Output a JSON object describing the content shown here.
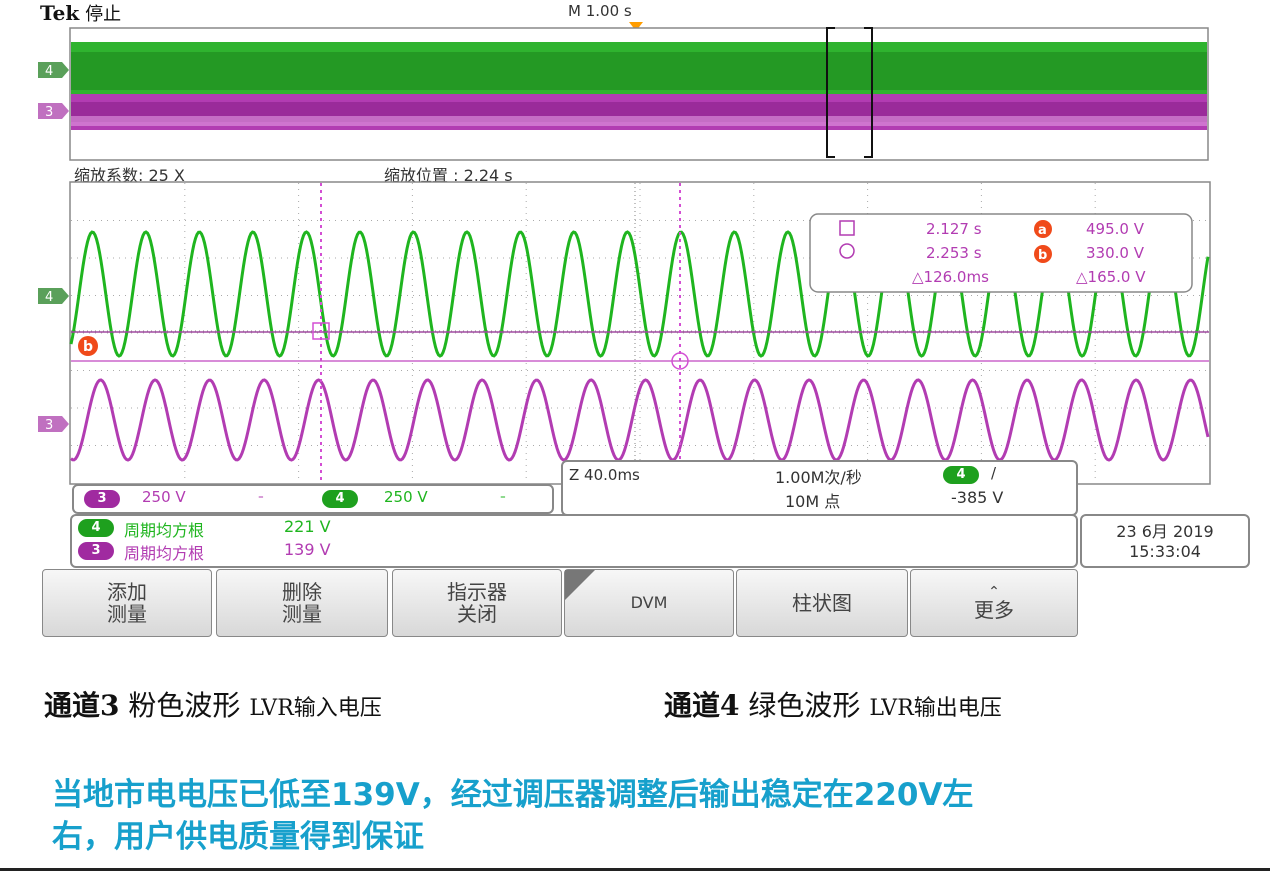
{
  "header": {
    "brand": "Tek",
    "status": "停止",
    "timebase": "M 1.00 s"
  },
  "zoom": {
    "factor_label": "缩放系数: 25 X",
    "position_label": "缩放位置 :  2.24 s"
  },
  "channels": [
    {
      "id": "4",
      "color": "#1fb51f",
      "scale": "250 V"
    },
    {
      "id": "3",
      "color": "#b23cb2",
      "scale": "250 V"
    }
  ],
  "colors": {
    "ch4": "#1fb51f",
    "ch3": "#b23cb2",
    "cursor": "#d34fd3",
    "trigger": "#ff9d00",
    "note": "#17a0cc"
  },
  "cursors": {
    "t1": "2.127 s",
    "v_a": "495.0 V",
    "t2": "2.253 s",
    "v_b": "330.0 V",
    "dt": "△126.0ms",
    "dv": "△165.0 V",
    "label_a": "a",
    "label_b": "b"
  },
  "timebase_panel": {
    "zoom_time": "Z 40.0ms",
    "sample_rate": "1.00M次/秒",
    "points": "10M 点",
    "trigger_channel": "4",
    "trigger_slope": "/",
    "trigger_level": "-385 V"
  },
  "measurements": [
    {
      "ch": "4",
      "label": "周期均方根",
      "value": "221 V"
    },
    {
      "ch": "3",
      "label": "周期均方根",
      "value": "139 V"
    }
  ],
  "datetime": {
    "date": "23 6月 2019",
    "time": "15:33:04"
  },
  "menu": [
    {
      "line1": "添加",
      "line2": "测量"
    },
    {
      "line1": "删除",
      "line2": "测量"
    },
    {
      "line1": "指示器",
      "line2": "关闭"
    },
    {
      "line1": "DVM",
      "line2": ""
    },
    {
      "line1": "柱状图",
      "line2": ""
    },
    {
      "line1": "更多",
      "line2": ""
    }
  ],
  "captions": {
    "ch3_name": "通道3",
    "ch3_desc": "粉色波形",
    "ch3_signal": "LVR输入电压",
    "ch4_name": "通道4",
    "ch4_desc": "绿色波形",
    "ch4_signal": "LVR输出电压"
  },
  "note": {
    "line1": "当地市电电压已低至139V，经过调压器调整后输出稳定在220V左",
    "line2": "右，用户供电质量得到保证"
  }
}
